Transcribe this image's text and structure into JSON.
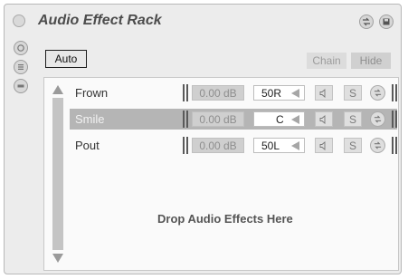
{
  "rack": {
    "title": "Audio Effect Rack"
  },
  "controls": {
    "auto_label": "Auto",
    "chain_label": "Chain",
    "hide_label": "Hide"
  },
  "chains": [
    {
      "name": "Frown",
      "volume": "0.00 dB",
      "pan": "50R",
      "mute_icon": "speaker-icon",
      "solo": "S"
    },
    {
      "name": "Smile",
      "volume": "0.00 dB",
      "pan": "C",
      "mute_icon": "speaker-icon",
      "solo": "S"
    },
    {
      "name": "Pout",
      "volume": "0.00 dB",
      "pan": "50L",
      "mute_icon": "speaker-icon",
      "solo": "S"
    }
  ],
  "drop_zone": {
    "text": "Drop Audio Effects Here"
  },
  "colors": {
    "background": "#ececec",
    "selected_row": "#b5b5b5",
    "panel": "#fafafa"
  },
  "icons": [
    "power-icon",
    "hot-swap-icon",
    "save-preset-icon",
    "macro-icon",
    "chain-list-icon",
    "devices-icon",
    "speaker-icon"
  ]
}
